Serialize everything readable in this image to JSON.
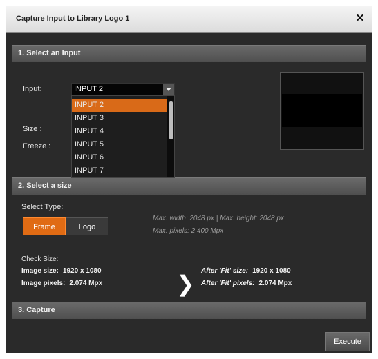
{
  "dialog": {
    "title": "Capture Input to Library Logo 1",
    "close_symbol": "✕"
  },
  "section1": {
    "header": "1. Select an Input",
    "input_label": "Input:",
    "input_value": "INPUT 2",
    "size_label": "Size :",
    "freeze_label": "Freeze :",
    "dropdown_options": [
      "INPUT 2",
      "INPUT 3",
      "INPUT 4",
      "INPUT 5",
      "INPUT 6",
      "INPUT 7"
    ],
    "selected_option": "INPUT 2"
  },
  "section2": {
    "header": "2. Select a size",
    "select_type_label": "Select Type:",
    "frame_label": "Frame",
    "logo_label": "Logo",
    "max_info_line1": "Max. width: 2048 px  |  Max. height: 2048 px",
    "max_info_line2": "Max. pixels: 2 400 Mpx",
    "check_size_label": "Check Size:",
    "image_size_label": "Image size:",
    "image_size_value": "1920 x 1080",
    "image_pixels_label": "Image pixels:",
    "image_pixels_value": "2.074 Mpx",
    "after_fit_size_label": "After 'Fit' size:",
    "after_fit_size_value": "1920 x 1080",
    "after_fit_pixels_label": "After 'Fit' pixels:",
    "after_fit_pixels_value": "2.074 Mpx",
    "arrow_symbol": "❯"
  },
  "section3": {
    "header": "3. Capture",
    "execute_label": "Execute"
  },
  "colors": {
    "accent": "#e06b14",
    "panel": "#2a2a2a",
    "header": "#5a5a5a"
  }
}
